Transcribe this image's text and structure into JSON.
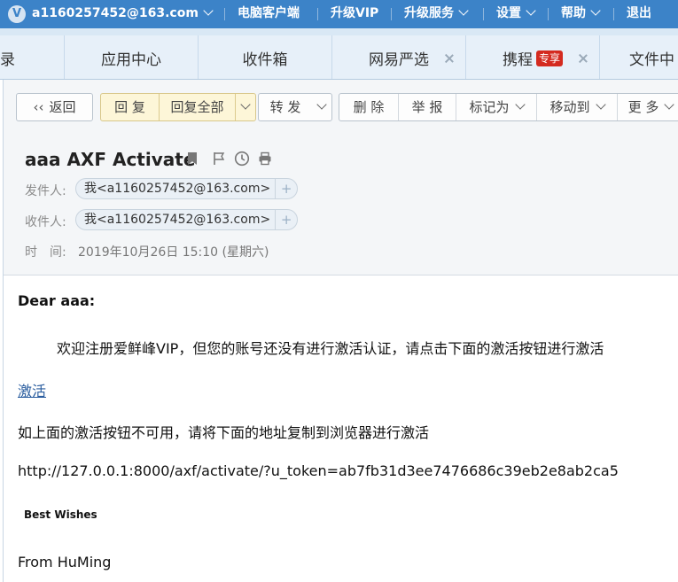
{
  "topbar": {
    "avatar_letter": "V",
    "account": "a1160257452@163.com",
    "pc_client": "电脑客户端",
    "upgrade_vip": "升级VIP",
    "upgrade_service": "升级服务",
    "settings": "设置",
    "help": "帮助",
    "logout": "退出"
  },
  "tabs": [
    {
      "label": "录"
    },
    {
      "label": "应用中心"
    },
    {
      "label": "收件箱"
    },
    {
      "label": "网易严选"
    },
    {
      "label": "携程",
      "badge": "专享"
    },
    {
      "label": "文件中心"
    }
  ],
  "toolbar": {
    "back": "返回",
    "reply": "回 复",
    "reply_all": "回复全部",
    "forward": "转 发",
    "delete": "删 除",
    "report": "举 报",
    "mark_as": "标记为",
    "move_to": "移动到",
    "more": "更 多"
  },
  "mail": {
    "subject": "aaa AXF Activate",
    "from_label": "发件人:",
    "from_value": "我<a1160257452@163.com>",
    "to_label": "收件人:",
    "to_value": "我<a1160257452@163.com>",
    "time_label": "时　间:",
    "time_value": "2019年10月26日 15:10 (星期六)",
    "plus": "+"
  },
  "body": {
    "greeting": "Dear aaa:",
    "welcome": "欢迎注册爱鲜峰VIP，但您的账号还没有进行激活认证，请点击下面的激活按钮进行激活",
    "activate_link": "激活",
    "fallback": "如上面的激活按钮不可用，请将下面的地址复制到浏览器进行激活",
    "url": "http://127.0.0.1:8000/axf/activate/?u_token=ab7fb31d3ee7476686c39eb2e8ab2ca5",
    "best_wishes": "Best Wishes",
    "signature": "From HuMing"
  },
  "colors": {
    "topbar": "#3c83c8",
    "tab_strip": "#d9e8f5",
    "reply_button": "#fdf6d8",
    "badge": "#d42a1f",
    "link": "#2a5d9f"
  }
}
